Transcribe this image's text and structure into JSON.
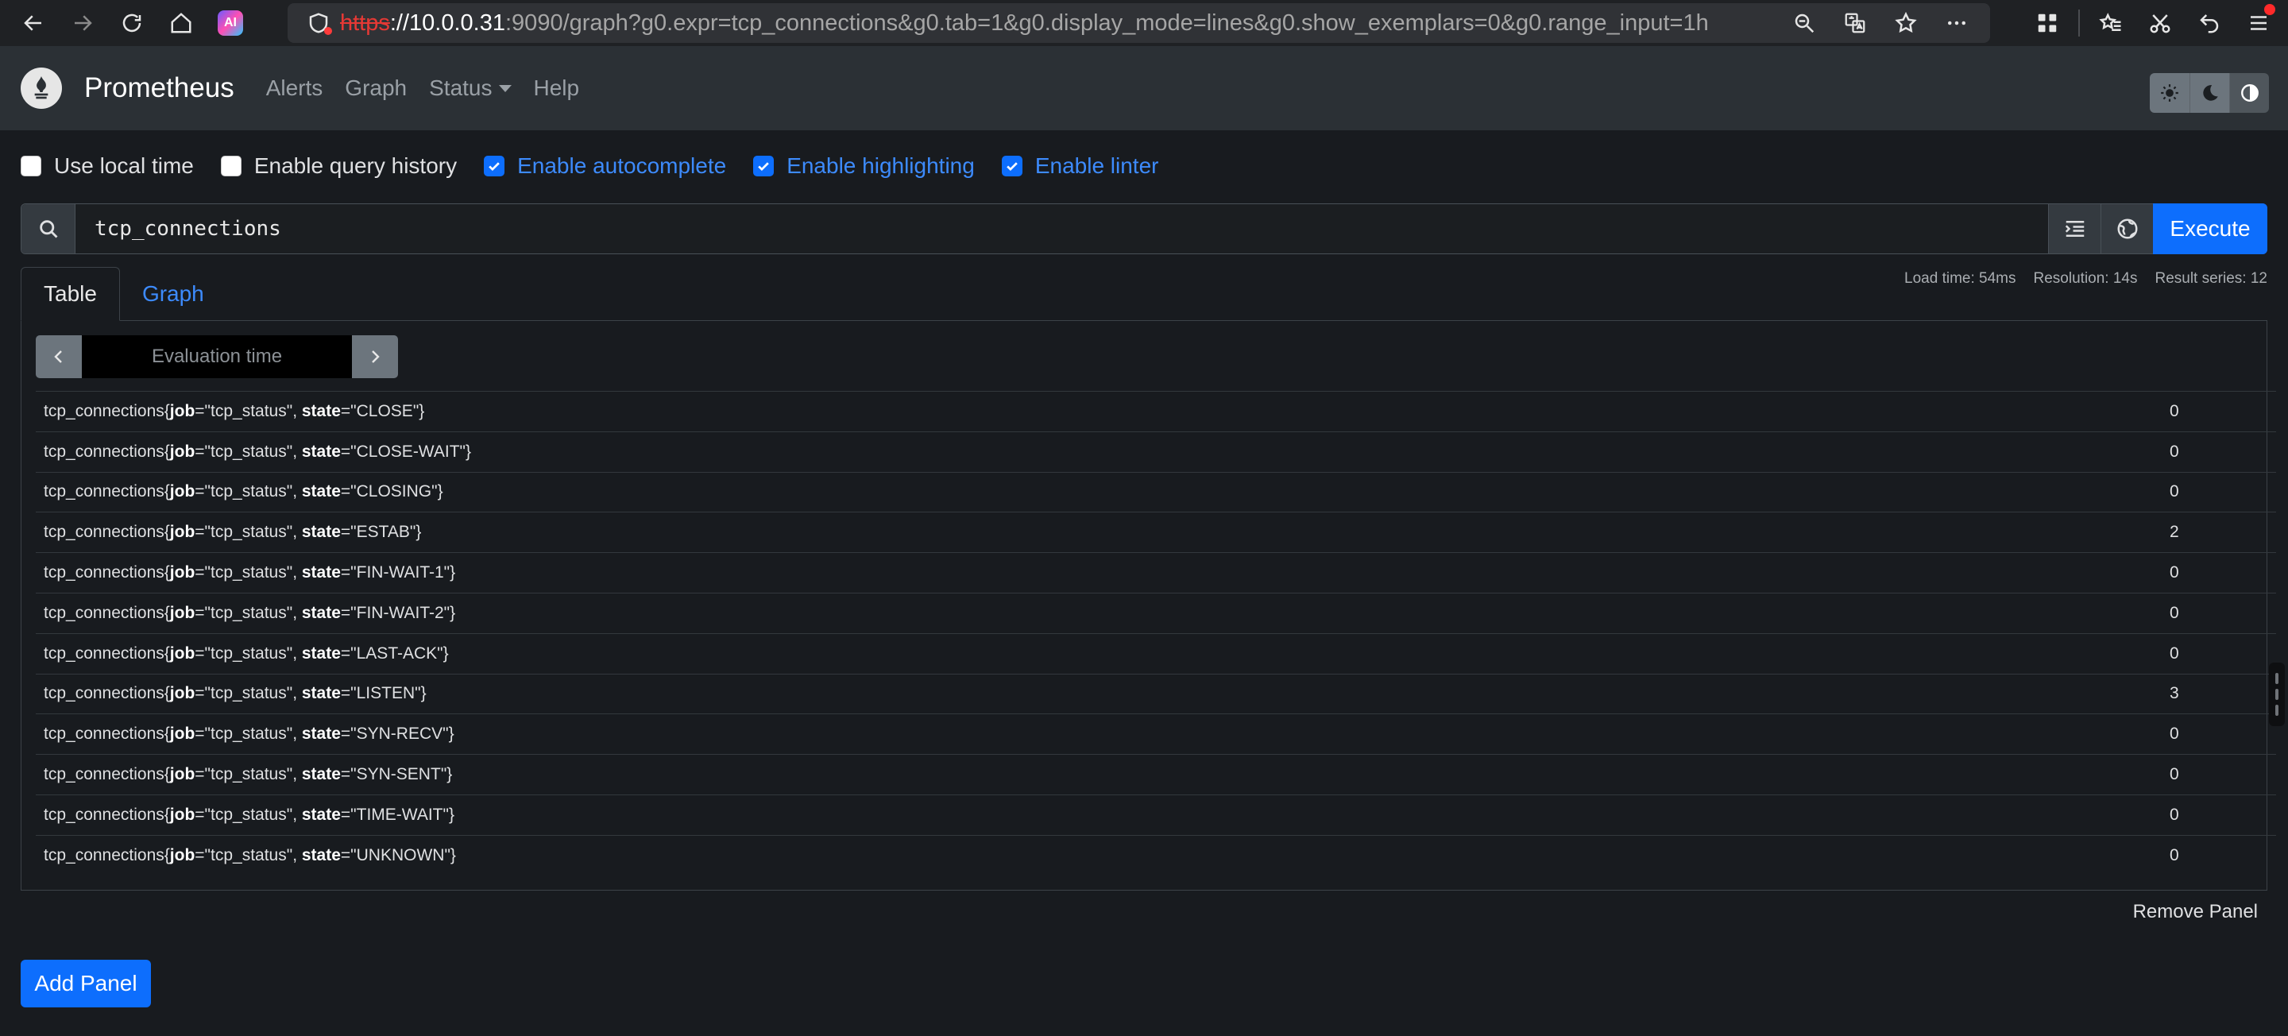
{
  "browser": {
    "url_protocol": "https",
    "url_host": "://10.0.0.31",
    "url_rest": ":9090/graph?g0.expr=tcp_connections&g0.tab=1&g0.display_mode=lines&g0.show_exemplars=0&g0.range_input=1h",
    "ai_badge": "AI"
  },
  "navbar": {
    "brand": "Prometheus",
    "links": {
      "alerts": "Alerts",
      "graph": "Graph",
      "status": "Status",
      "help": "Help"
    }
  },
  "options": {
    "use_local_time": {
      "label": "Use local time",
      "checked": false
    },
    "enable_query_history": {
      "label": "Enable query history",
      "checked": false
    },
    "enable_autocomplete": {
      "label": "Enable autocomplete",
      "checked": true
    },
    "enable_highlighting": {
      "label": "Enable highlighting",
      "checked": true
    },
    "enable_linter": {
      "label": "Enable linter",
      "checked": true
    }
  },
  "query": {
    "expression": "tcp_connections",
    "execute_label": "Execute"
  },
  "stats": {
    "load_time": "Load time: 54ms",
    "resolution": "Resolution: 14s",
    "result_series": "Result series: 12"
  },
  "tabs": {
    "table": "Table",
    "graph": "Graph"
  },
  "eval": {
    "placeholder": "Evaluation time"
  },
  "results": [
    {
      "metric": "tcp_connections",
      "job": "tcp_status",
      "state": "CLOSE",
      "value": "0"
    },
    {
      "metric": "tcp_connections",
      "job": "tcp_status",
      "state": "CLOSE-WAIT",
      "value": "0"
    },
    {
      "metric": "tcp_connections",
      "job": "tcp_status",
      "state": "CLOSING",
      "value": "0"
    },
    {
      "metric": "tcp_connections",
      "job": "tcp_status",
      "state": "ESTAB",
      "value": "2"
    },
    {
      "metric": "tcp_connections",
      "job": "tcp_status",
      "state": "FIN-WAIT-1",
      "value": "0"
    },
    {
      "metric": "tcp_connections",
      "job": "tcp_status",
      "state": "FIN-WAIT-2",
      "value": "0"
    },
    {
      "metric": "tcp_connections",
      "job": "tcp_status",
      "state": "LAST-ACK",
      "value": "0"
    },
    {
      "metric": "tcp_connections",
      "job": "tcp_status",
      "state": "LISTEN",
      "value": "3"
    },
    {
      "metric": "tcp_connections",
      "job": "tcp_status",
      "state": "SYN-RECV",
      "value": "0"
    },
    {
      "metric": "tcp_connections",
      "job": "tcp_status",
      "state": "SYN-SENT",
      "value": "0"
    },
    {
      "metric": "tcp_connections",
      "job": "tcp_status",
      "state": "TIME-WAIT",
      "value": "0"
    },
    {
      "metric": "tcp_connections",
      "job": "tcp_status",
      "state": "UNKNOWN",
      "value": "0"
    }
  ],
  "panel": {
    "remove_label": "Remove Panel",
    "add_label": "Add Panel"
  },
  "colors": {
    "accent": "#0d6efd",
    "link": "#3d8bfd",
    "background": "#181b1f",
    "navbar": "#2b3035"
  }
}
